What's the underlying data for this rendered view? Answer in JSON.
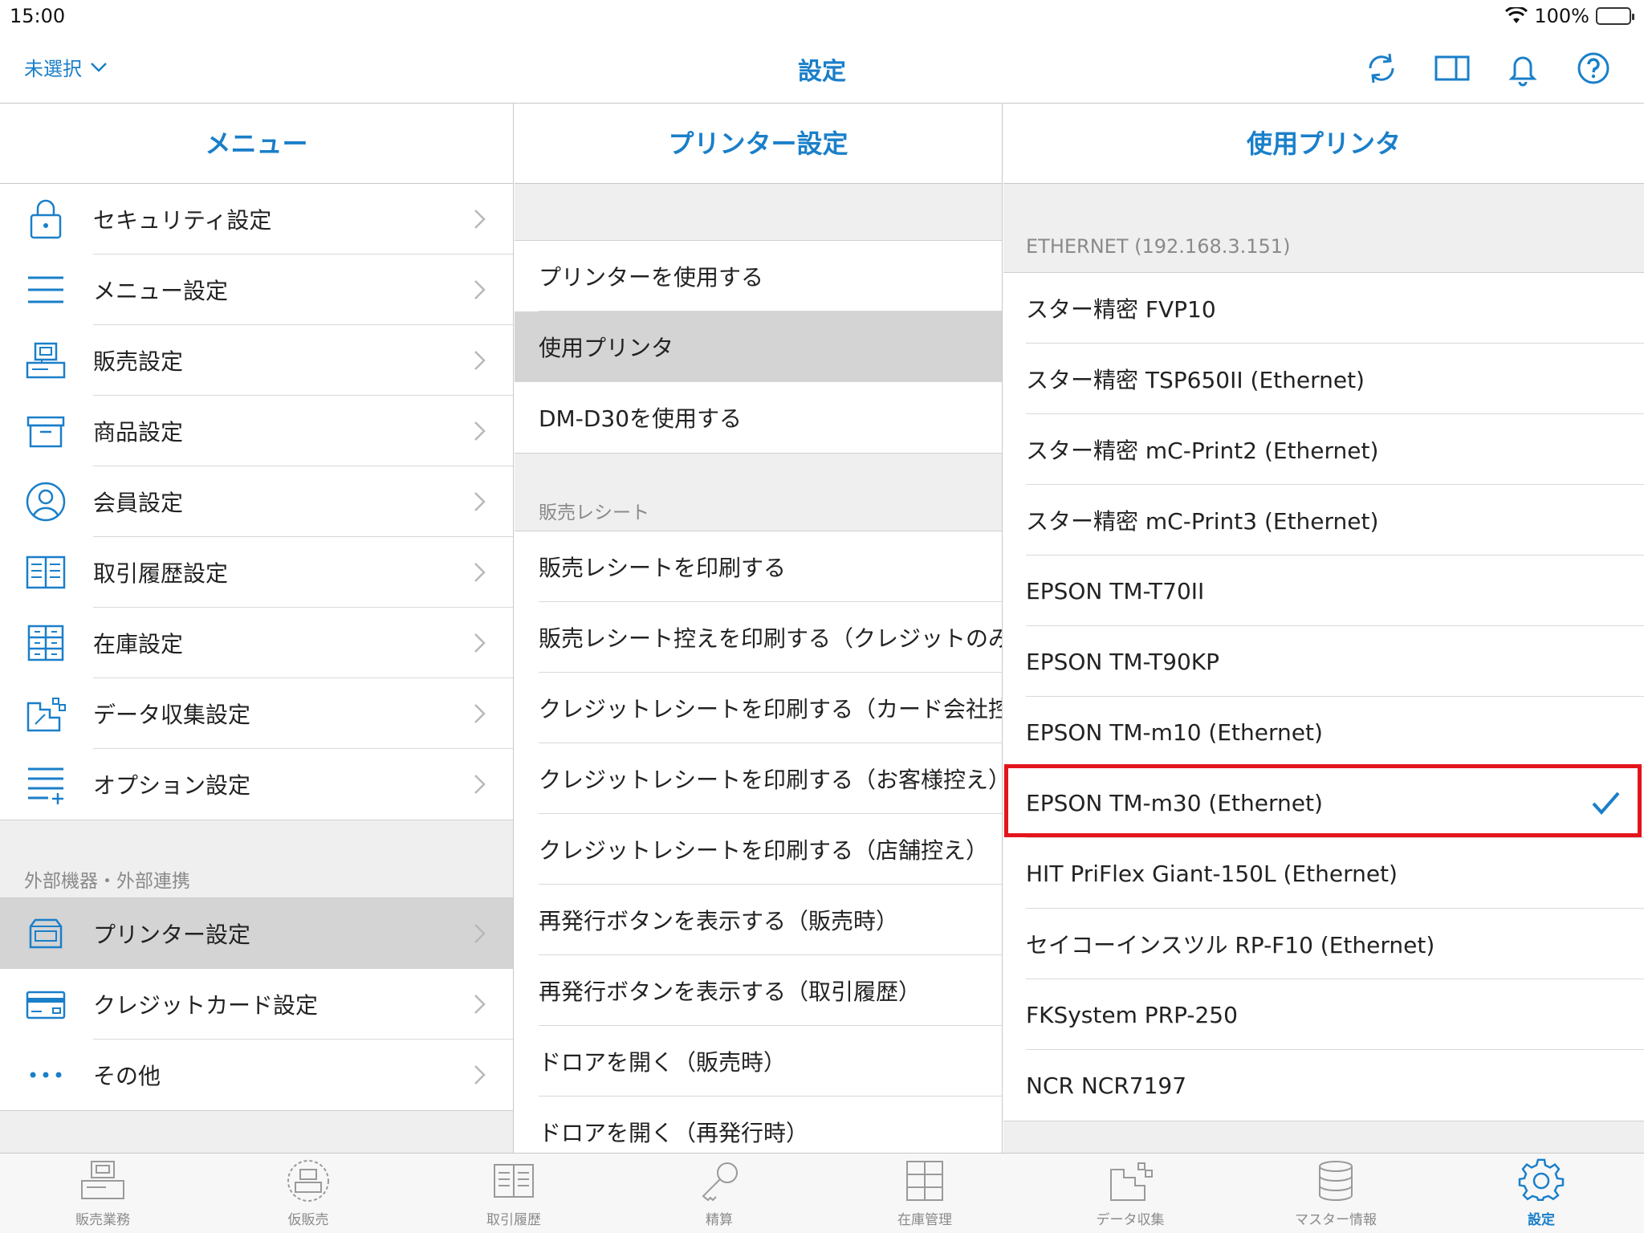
{
  "status": {
    "time": "15:00",
    "battery": "100%"
  },
  "nav": {
    "unselected": "未選択",
    "title": "設定"
  },
  "menu": {
    "header": "メニュー",
    "items": [
      {
        "label": "セキュリティ設定",
        "icon": "lock-icon"
      },
      {
        "label": "メニュー設定",
        "icon": "menu-lines-icon"
      },
      {
        "label": "販売設定",
        "icon": "register-icon"
      },
      {
        "label": "商品設定",
        "icon": "box-icon"
      },
      {
        "label": "会員設定",
        "icon": "user-icon"
      },
      {
        "label": "取引履歴設定",
        "icon": "book-icon"
      },
      {
        "label": "在庫設定",
        "icon": "cabinet-icon"
      },
      {
        "label": "データ収集設定",
        "icon": "data-collect-icon"
      },
      {
        "label": "オプション設定",
        "icon": "option-list-icon"
      }
    ],
    "section2_label": "外部機器・外部連携",
    "items2": [
      {
        "label": "プリンター設定",
        "icon": "printer-icon"
      },
      {
        "label": "クレジットカード設定",
        "icon": "credit-card-icon"
      },
      {
        "label": "その他",
        "icon": "more-icon"
      }
    ]
  },
  "printer_settings": {
    "header": "プリンター設定",
    "group1": [
      "プリンターを使用する",
      "使用プリンタ",
      "DM-D30を使用する"
    ],
    "section_label": "販売レシート",
    "group2": [
      "販売レシートを印刷する",
      "販売レシート控えを印刷する（クレジットのみ）",
      "クレジットレシートを印刷する（カード会社控え）",
      "クレジットレシートを印刷する（お客様控え）",
      "クレジットレシートを印刷する（店舗控え）",
      "再発行ボタンを表示する（販売時）",
      "再発行ボタンを表示する（取引履歴）",
      "ドロアを開く（販売時）",
      "ドロアを開く（再発行時）"
    ]
  },
  "printers": {
    "header": "使用プリンタ",
    "section_label": "ETHERNET (192.168.3.151)",
    "items": [
      "スター精密 FVP10",
      "スター精密 TSP650II (Ethernet)",
      "スター精密 mC-Print2 (Ethernet)",
      "スター精密 mC-Print3 (Ethernet)",
      "EPSON TM-T70II",
      "EPSON TM-T90KP",
      "EPSON TM-m10 (Ethernet)",
      "EPSON TM-m30 (Ethernet)",
      "HIT PriFlex Giant-150L (Ethernet)",
      "セイコーインスツル RP-F10 (Ethernet)",
      "FKSystem PRP-250",
      "NCR NCR7197"
    ],
    "selected_index": 7
  },
  "tabs": [
    {
      "label": "販売業務",
      "icon": "register-icon"
    },
    {
      "label": "仮販売",
      "icon": "temp-sale-icon"
    },
    {
      "label": "取引履歴",
      "icon": "book-icon"
    },
    {
      "label": "精算",
      "icon": "key-icon"
    },
    {
      "label": "在庫管理",
      "icon": "cabinet-icon"
    },
    {
      "label": "データ収集",
      "icon": "data-collect-icon"
    },
    {
      "label": "マスター情報",
      "icon": "database-icon"
    },
    {
      "label": "設定",
      "icon": "gear-icon"
    }
  ],
  "colors": {
    "accent": "#1a7fc9",
    "highlight": "#e4141b",
    "selected_row": "#d4d4d4"
  }
}
